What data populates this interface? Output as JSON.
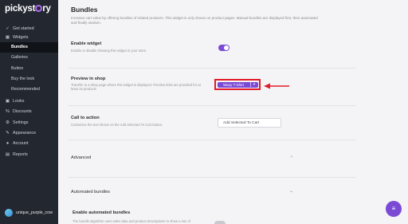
{
  "brand": {
    "logo_text_pre": "pickyst",
    "logo_text_post": "ry"
  },
  "sidebar": {
    "items": [
      {
        "label": "Get started",
        "icon": "check-circle-icon"
      },
      {
        "label": "Widgets",
        "icon": "grid-icon"
      }
    ],
    "widget_subitems": [
      {
        "label": "Bundles",
        "active": true
      },
      {
        "label": "Galleries",
        "active": false
      },
      {
        "label": "Button",
        "active": false
      },
      {
        "label": "Buy the look",
        "active": false
      },
      {
        "label": "Recommended",
        "active": false
      }
    ],
    "items_after": [
      {
        "label": "Looks",
        "icon": "image-icon"
      },
      {
        "label": "Discounts",
        "icon": "percent-icon"
      },
      {
        "label": "Settings",
        "icon": "gear-icon"
      },
      {
        "label": "Appearance",
        "icon": "paint-icon"
      },
      {
        "label": "Account",
        "icon": "person-icon"
      },
      {
        "label": "Reports",
        "icon": "chart-icon"
      }
    ],
    "user": "unique_purple_cow"
  },
  "page": {
    "title": "Bundles",
    "description": "Increase cart value by offering bundles of related products. This widget is only shown on product pages. Manual bundles are displayed first, then automated and finally random."
  },
  "enable_widget": {
    "title": "Enable widget",
    "description": "Enable or disable showing this widget in your store.",
    "enabled": true
  },
  "preview": {
    "title": "Preview in shop",
    "description": "Transfer to a shop page where this widget is displayed. Preview links are provided for at least 15 products",
    "selected": "Wavy T-Shirt"
  },
  "call_to_action": {
    "title": "Call to action",
    "description": "Customize the text shown on the Add Selected To Cart button.",
    "value": "Add Selected To Cart"
  },
  "advanced": {
    "title": "Advanced"
  },
  "automated": {
    "title": "Automated bundles",
    "enable_title": "Enable automated bundles",
    "enable_desc": "The bundle algorithm uses sales data and product descriptions to show a mix of"
  },
  "colors": {
    "accent": "#7b4ad5",
    "highlight": "#e21b2a",
    "sidebar": "#232830"
  }
}
